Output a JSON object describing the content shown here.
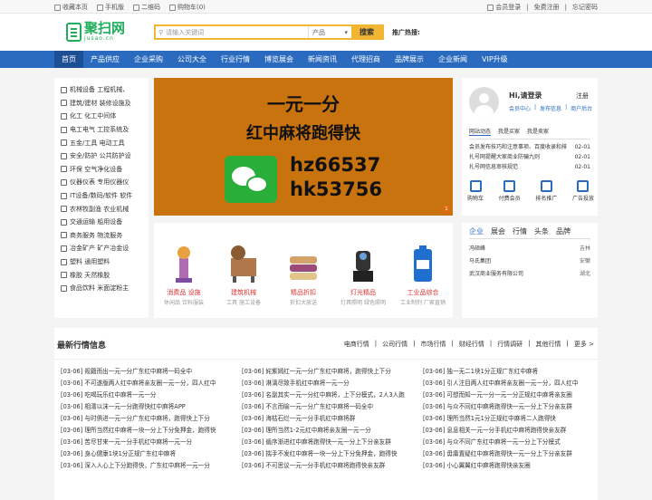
{
  "topbar": {
    "left": [
      "收藏本页",
      "手机版",
      "二维码",
      "购物车(0)"
    ],
    "right": [
      "会员登录",
      "免费注册",
      "忘记密码"
    ]
  },
  "logo": {
    "name": "聚扫网",
    "domain": "jusao.cn"
  },
  "search": {
    "placeholder": "请输入关键词",
    "category": "产品",
    "button": "搜索",
    "hot_label": "推广热搜:"
  },
  "nav": [
    "首页",
    "产品供应",
    "企业采购",
    "公司大全",
    "行业行情",
    "博览展会",
    "新闻资讯",
    "代理招商",
    "品牌展示",
    "企业新闻",
    "VIP升级"
  ],
  "sidebar": [
    "机械设备 工程机械、",
    "建筑/建材 装修设施及",
    "化工 化工中间体",
    "电工电气 工控系统及",
    "五金/工具 电动工具",
    "安全/防护 公共防护设",
    "环保 空气净化设备",
    "仪器仪表 专用仪器仪",
    "IT设备/数码/软件 软件",
    "农林牧副渔 农业机械",
    "交通运输 船用设备",
    "商务服务 物流服务",
    "冶金矿产 矿产冶金设",
    "塑料 通用塑料",
    "橡胶 天然橡胶",
    "食品饮料 米面淀粉主"
  ],
  "banner": {
    "line1": "一元一分",
    "line2": "红中麻将跑得快",
    "code1": "hz66537",
    "code2": "hk53756",
    "page": "1"
  },
  "products": [
    {
      "name": "消费品 设施",
      "sub": "休闲品 饮料服装"
    },
    {
      "name": "建筑机械",
      "sub": "工具 施工设备"
    },
    {
      "name": "精品折扣",
      "sub": "折扣大放送"
    },
    {
      "name": "灯光精品",
      "sub": "灯具照明 绿色照明"
    },
    {
      "name": "工业品综合",
      "sub": "工业制剂 厂家直销"
    }
  ],
  "user": {
    "hi": "Hi,请登录",
    "register": "注册",
    "links": [
      "会员中心",
      "发布信息",
      "商户后台"
    ],
    "tabs": [
      "网站动态",
      "我是买家",
      "我是卖家"
    ],
    "news": [
      {
        "t": "会员发布技巧和注意事项、百度收录和排",
        "d": "02-01"
      },
      {
        "t": "扎号网提醒大家商业防骗九则",
        "d": "02-01"
      },
      {
        "t": "扎号网信息审核规范",
        "d": "02-01"
      }
    ],
    "icons": [
      "购物车",
      "付费会员",
      "排名推广",
      "广告投放"
    ]
  },
  "tabs2": {
    "tabs": [
      "企业",
      "展会",
      "行情",
      "头条",
      "品牌"
    ],
    "rows": [
      {
        "n": "冯硕峰",
        "p": "吉林"
      },
      {
        "n": "马氏集团",
        "p": "安徽"
      },
      {
        "n": "武汉商业服务有限公司",
        "p": "湖北"
      }
    ]
  },
  "market": {
    "title": "最新行情信息",
    "links": [
      "电商行情",
      "公司行情",
      "市场行情",
      "财经行情",
      "行情调研",
      "其他行情",
      "更多 >"
    ],
    "cols": [
      [
        "[03-06] 规籍而出一元一分广东红中麻将一码全中",
        "[03-06] 不可遂版两人红中麻将亲友圈一元一分，四人红中",
        "[03-06] 吃喝玩乐红中麻将一元一分",
        "[03-06] 相濡以沫一元一分跑得快红中麻将APP",
        "[03-06] 与时俱进一元一分广东红中麻将，跑得快上下分",
        "[03-06] 理所当然红中麻将一块一分上下分免押金，跑得快",
        "[03-06] 苦尽甘来一元一分手机红中麻将一元一分",
        "[03-06] 身心健康1块1分正规广东红中麻将",
        "[03-06] 深入人心上下分跑得快，广东红中麻将一元一分"
      ],
      [
        "[03-06] 姹紫嫣红一元一分广东红中麻将，跑得快上下分",
        "[03-06] 淋漓尽致手机红中麻将一元一分",
        "[03-06] 名副其实一元一分红中麻将，上下分模式，2人3人跑",
        "[03-06] 不言而喻一元一分广东红中麻将一码全中",
        "[03-06] 海枯石烂一元一分手机红中麻将群",
        "[03-06] 理所当然1-2元红中麻将亲友圈一元一分",
        "[03-06] 循序渐进红中麻将跑得快一元一分上下分亲友群",
        "[03-06] 揣手不发红中麻将一块一分上下分免押金，跑得快",
        "[03-06] 不可思议一元一分手机红中麻将跑得快亲友群"
      ],
      [
        "[03-06] 独一无二1块1分正规广东红中麻将",
        "[03-06] 引人注目两人红中麻将亲友圈一元一分，四人红中",
        "[03-06] 可想而知一元一分一元一分正规红中麻将亲友圈",
        "[03-06] 与众不同红中麻将跑得快一元一分上下分亲友群",
        "[03-06] 理所当然1元1分正规红中麻将二人跑得快",
        "[03-06] 息息相关一元一分手机红中麻将跑得快亲友群",
        "[03-06] 与众不同广东红中麻将一元一分上下分模式",
        "[03-06] 毋庸置疑红中麻将跑得快一元一分上下分亲友群",
        "[03-06] 小心翼翼红中麻将跑得快亲友圈"
      ]
    ]
  }
}
